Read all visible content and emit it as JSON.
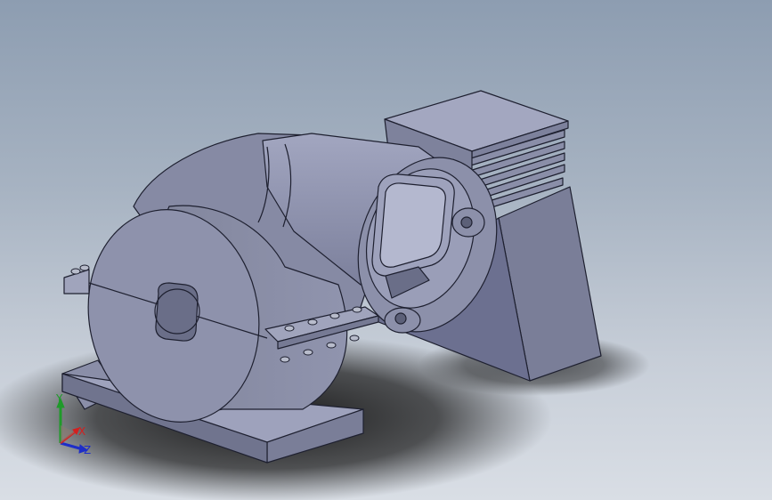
{
  "viewport": {
    "background_top": "#8d9db1",
    "background_bottom": "#d9dee5",
    "model": {
      "body_color": "#8a8ea8",
      "light_face": "#9a9eb8",
      "dark_face": "#6e7290",
      "edge_color": "#1e2030"
    },
    "triad": {
      "x_label": "X",
      "y_label": "Y",
      "z_label": "Z",
      "x_color": "#d22020",
      "y_color": "#1f9a2a",
      "z_color": "#1e2ec8"
    }
  }
}
